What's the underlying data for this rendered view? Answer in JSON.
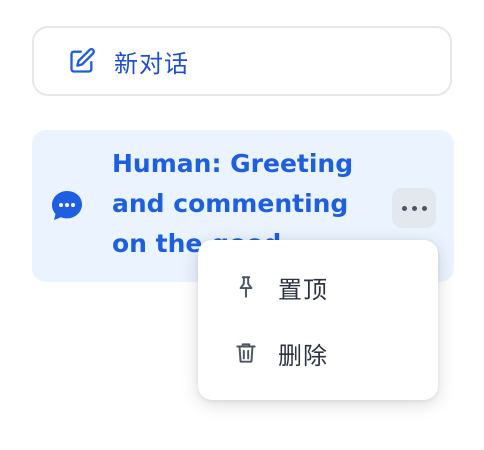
{
  "new_chat": {
    "label": "新对话",
    "icon": "edit-icon"
  },
  "conversation": {
    "title": "Human: Greeting and commenting on the good weather",
    "icon": "chat-bubble-icon",
    "more_icon": "more-horizontal-icon",
    "selected": true
  },
  "context_menu": {
    "items": [
      {
        "label": "置顶",
        "icon": "pin-icon"
      },
      {
        "label": "删除",
        "icon": "trash-icon"
      }
    ]
  },
  "colors": {
    "accent": "#1d5fe0",
    "selected_bg": "#eaf3fe",
    "border": "#e5e7eb"
  }
}
